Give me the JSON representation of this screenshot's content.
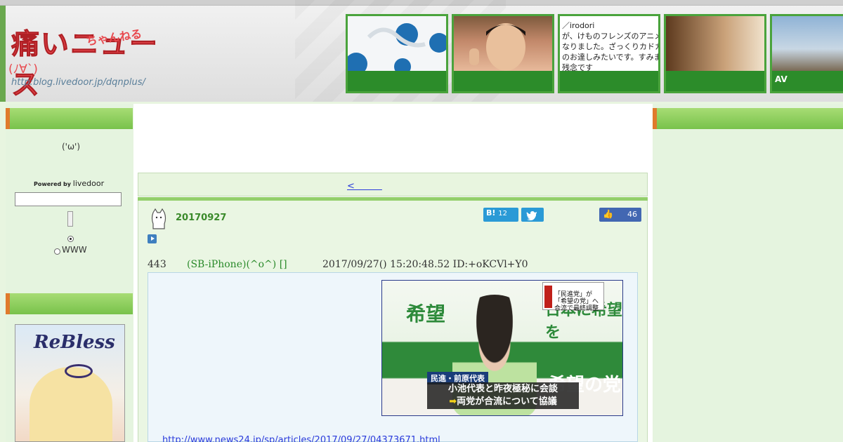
{
  "header": {
    "logo_main": "痛いニュース",
    "logo_sub": "ちゃんねる",
    "logo_face": "(ﾉ∀`)",
    "logo_url": "http:blog.livedoor.jp/dqnplus/"
  },
  "thumbnails": [
    {
      "caption": "",
      "text": ""
    },
    {
      "caption": "",
      "text": ""
    },
    {
      "caption": "",
      "text": "／irodori\nが、けものフレンズのアニメ\nなりました。ざっくりカドカ\nのお達しみたいです。すみま\n残念です"
    },
    {
      "caption": "",
      "text": ""
    },
    {
      "caption": "AV",
      "text": ""
    }
  ],
  "sidebar": {
    "face": "('ω')",
    "powered_label": "Powered by",
    "powered_brand": "livedoor",
    "search_placeholder": "",
    "radio_www_label": "WWW"
  },
  "book_ad": {
    "title": "ReBless"
  },
  "article": {
    "prev_link": "<　　　",
    "date": "20170927",
    "hatena_count": "12",
    "like_count": "46",
    "res_number": "443",
    "res_name": "(SB-iPhone)(^o^) []",
    "res_datetime": "2017/09/27() 15:20:48.52 ID:+oKCVl+Y0",
    "source_link": "http://www.news24.jp/sp/articles/2017/09/27/04373671.html"
  },
  "news_image": {
    "banner_left": "希望",
    "banner_right": "日本に希望を",
    "banner_lower": "希望の党",
    "ticker_text": "「民進党」が「希望の党」へ 合流で最終調整",
    "name_label": "民進・前原代表",
    "caption_line1": "小池代表と昨夜極秘に会談",
    "caption_arrow": "➡",
    "caption_line2": "両党が合流について協議"
  },
  "colors": {
    "accent_green": "#78c24b",
    "link_blue": "#2a3bdb",
    "logo_red": "#e8494e",
    "facebook_blue": "#4267b2",
    "twitter_blue": "#2a9ad6"
  }
}
